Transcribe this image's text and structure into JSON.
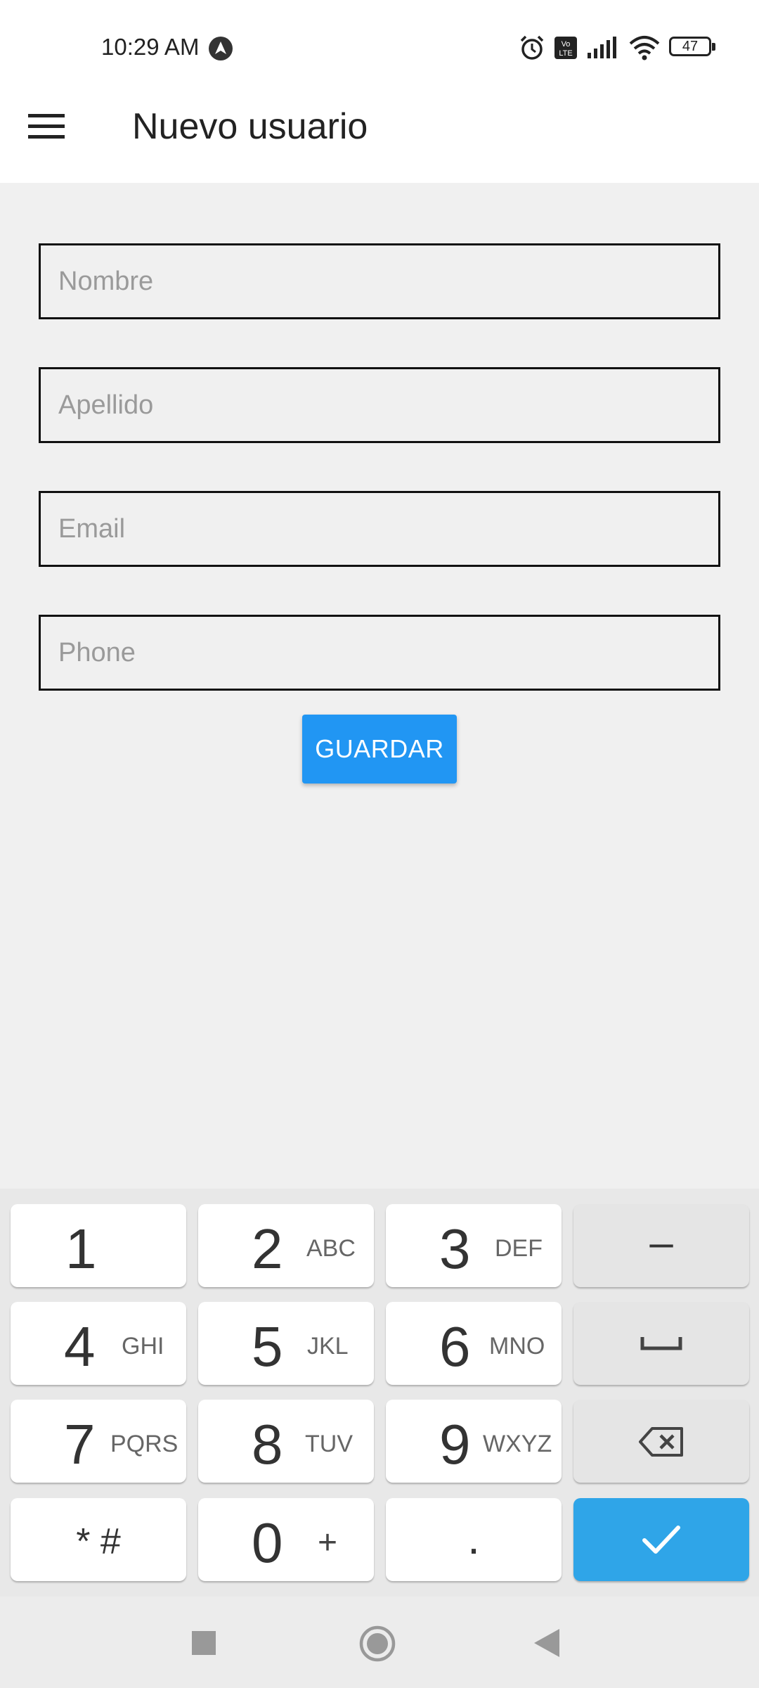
{
  "status_bar": {
    "time": "10:29 AM",
    "battery": "47",
    "icons": [
      "alarm-icon",
      "volte-icon",
      "signal-icon",
      "wifi-icon",
      "battery-icon"
    ]
  },
  "app_bar": {
    "title": "Nuevo usuario",
    "menu_icon": "hamburger-menu-icon"
  },
  "form": {
    "nombre": {
      "placeholder": "Nombre",
      "value": ""
    },
    "apellido": {
      "placeholder": "Apellido",
      "value": ""
    },
    "email": {
      "placeholder": "Email",
      "value": ""
    },
    "phone": {
      "placeholder": "Phone",
      "value": ""
    },
    "save_label": "GUARDAR"
  },
  "keyboard": {
    "keys": [
      {
        "main": "1",
        "sub": ""
      },
      {
        "main": "2",
        "sub": "ABC"
      },
      {
        "main": "3",
        "sub": "DEF"
      },
      {
        "main": "–",
        "sub": ""
      },
      {
        "main": "4",
        "sub": "GHI"
      },
      {
        "main": "5",
        "sub": "JKL"
      },
      {
        "main": "6",
        "sub": "MNO"
      },
      {
        "main": "",
        "sub": ""
      },
      {
        "main": "7",
        "sub": "PQRS"
      },
      {
        "main": "8",
        "sub": "TUV"
      },
      {
        "main": "9",
        "sub": "WXYZ"
      },
      {
        "main": "",
        "sub": ""
      },
      {
        "main": "* #",
        "sub": ""
      },
      {
        "main": "0",
        "sub": "+"
      },
      {
        "main": ".",
        "sub": ""
      },
      {
        "main": "",
        "sub": ""
      }
    ],
    "special_icons": {
      "space": "space-bar-icon",
      "backspace": "backspace-icon",
      "enter": "checkmark-icon"
    },
    "enter_color": "#2fa5e8"
  },
  "nav_bar": {
    "icons": [
      "recents-square-icon",
      "home-circle-icon",
      "back-triangle-icon"
    ]
  },
  "colors": {
    "accent": "#2196f3",
    "background": "#f0f0f0"
  }
}
